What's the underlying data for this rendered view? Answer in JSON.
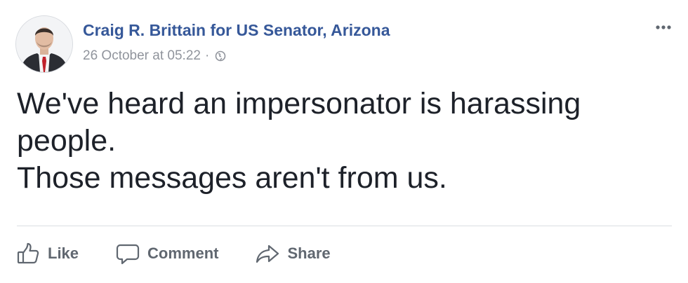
{
  "post": {
    "author": "Craig R. Brittain for US Senator, Arizona",
    "timestamp": "26 October at 05:22",
    "separator": "·",
    "privacy_icon": "globe-icon",
    "more_icon": "more-options-icon",
    "text_lines": [
      "We've heard an impersonator is harassing",
      "people.",
      "Those messages aren't from us."
    ]
  },
  "actions": {
    "like_label": "Like",
    "like_icon": "thumbs-up-icon",
    "comment_label": "Comment",
    "comment_icon": "speech-bubble-icon",
    "share_label": "Share",
    "share_icon": "share-arrow-icon"
  },
  "colors": {
    "author_link": "#365899",
    "meta_text": "#90949c",
    "body_text": "#1d2129",
    "action_text": "#606770",
    "divider": "#dadde1"
  }
}
